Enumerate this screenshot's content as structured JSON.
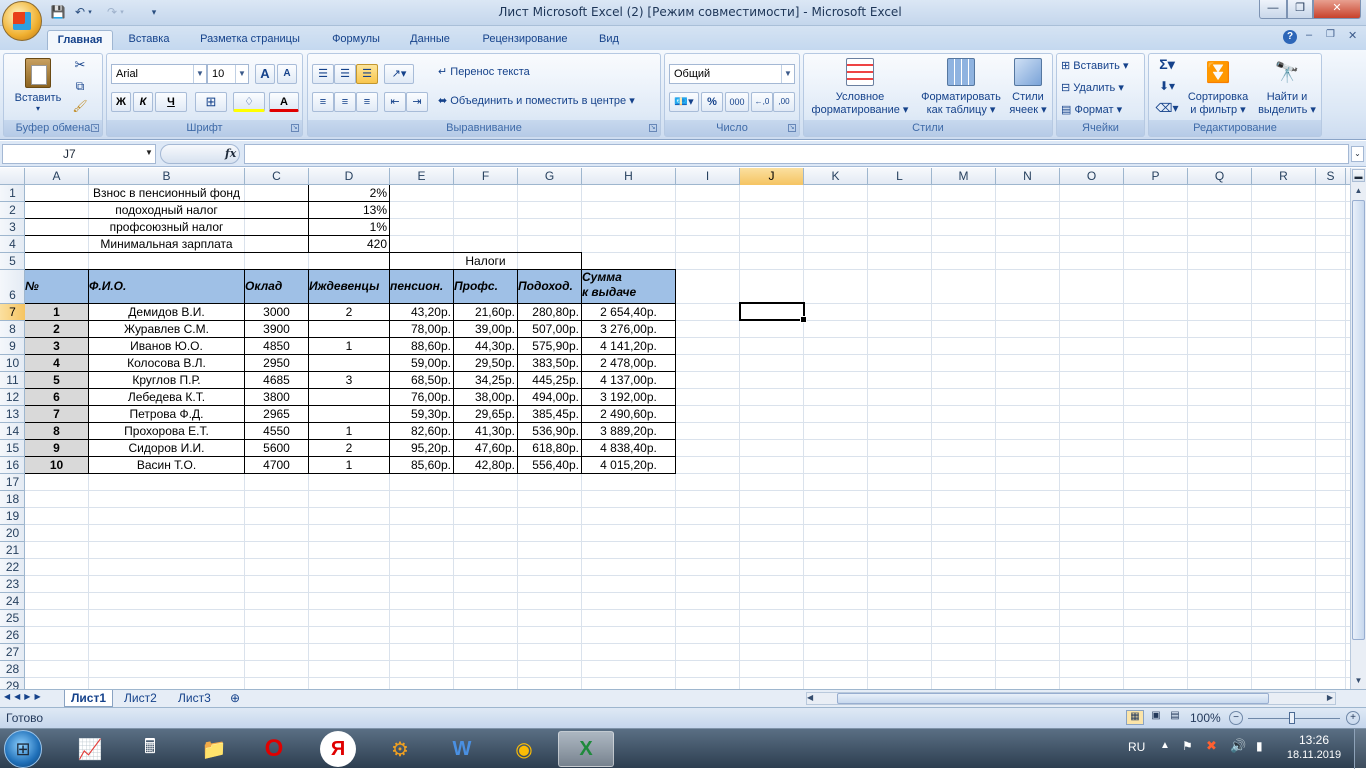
{
  "window": {
    "title": "Лист Microsoft Excel (2)  [Режим совместимости] - Microsoft Excel",
    "min": "—",
    "max": "❐",
    "close": "✕"
  },
  "ribbon_tabs": [
    "Главная",
    "Вставка",
    "Разметка страницы",
    "Формулы",
    "Данные",
    "Рецензирование",
    "Вид"
  ],
  "ribbon": {
    "clipboard": {
      "label": "Буфер обмена",
      "paste": "Вставить"
    },
    "font": {
      "label": "Шрифт",
      "name": "Arial",
      "size": "10",
      "bold": "Ж",
      "italic": "К",
      "underline": "Ч",
      "grow": "A",
      "shrink": "A",
      "color_letter": "A"
    },
    "alignment": {
      "label": "Выравнивание",
      "wrap": "Перенос текста",
      "merge": "Объединить и поместить в центре"
    },
    "number": {
      "label": "Число",
      "format": "Общий",
      "percent": "%",
      "thousands": "000",
      "inc": "←,0",
      "dec": ",00"
    },
    "styles": {
      "label": "Стили",
      "cond1": "Условное",
      "cond2": "форматирование",
      "table1": "Форматировать",
      "table2": "как таблицу",
      "cell1": "Стили",
      "cell2": "ячеек"
    },
    "cells": {
      "label": "Ячейки",
      "insert": "Вставить",
      "delete": "Удалить",
      "format": "Формат"
    },
    "editing": {
      "label": "Редактирование",
      "sort1": "Сортировка",
      "sort2": "и фильтр",
      "find1": "Найти и",
      "find2": "выделить",
      "sigma": "Σ"
    }
  },
  "formula_bar": {
    "name_box": "J7",
    "fx": "fx",
    "value": ""
  },
  "columns": [
    "A",
    "B",
    "C",
    "D",
    "E",
    "F",
    "G",
    "H",
    "I",
    "J",
    "K",
    "L",
    "M",
    "N",
    "O",
    "P",
    "Q",
    "R",
    "S"
  ],
  "rows": [
    "1",
    "2",
    "3",
    "4",
    "5",
    "6",
    "7",
    "8",
    "9",
    "10",
    "11",
    "12",
    "13",
    "14",
    "15",
    "16",
    "17",
    "18",
    "19",
    "20",
    "21",
    "22",
    "23",
    "24",
    "25",
    "26",
    "27",
    "28",
    "29"
  ],
  "selected": {
    "column": "J",
    "row": "7"
  },
  "params": [
    {
      "label": "Взнос в пенсионный фонд",
      "value": "2%"
    },
    {
      "label": "подоходный налог",
      "value": "13%"
    },
    {
      "label": "профсоюзный налог",
      "value": "1%"
    },
    {
      "label": "Минимальная зарплата",
      "value": "420"
    }
  ],
  "taxes_caption": "Налоги",
  "table_headers": [
    "№",
    "Ф.И.О.",
    "Оклад",
    "Иждевенцы",
    "пенсион.",
    "Профс.",
    "Подоход.",
    "Сумма",
    "к выдаче"
  ],
  "table_rows": [
    [
      "1",
      "Демидов В.И.",
      "3000",
      "2",
      "43,20р.",
      "21,60р.",
      "280,80р.",
      "2 654,40р."
    ],
    [
      "2",
      "Журавлев С.М.",
      "3900",
      "",
      "78,00р.",
      "39,00р.",
      "507,00р.",
      "3 276,00р."
    ],
    [
      "3",
      "Иванов Ю.О.",
      "4850",
      "1",
      "88,60р.",
      "44,30р.",
      "575,90р.",
      "4 141,20р."
    ],
    [
      "4",
      "Колосова В.Л.",
      "2950",
      "",
      "59,00р.",
      "29,50р.",
      "383,50р.",
      "2 478,00р."
    ],
    [
      "5",
      "Круглов П.Р.",
      "4685",
      "3",
      "68,50р.",
      "34,25р.",
      "445,25р.",
      "4 137,00р."
    ],
    [
      "6",
      "Лебедева К.Т.",
      "3800",
      "",
      "76,00р.",
      "38,00р.",
      "494,00р.",
      "3 192,00р."
    ],
    [
      "7",
      "Петрова Ф.Д.",
      "2965",
      "",
      "59,30р.",
      "29,65р.",
      "385,45р.",
      "2 490,60р."
    ],
    [
      "8",
      "Прохорова Е.Т.",
      "4550",
      "1",
      "82,60р.",
      "41,30р.",
      "536,90р.",
      "3 889,20р."
    ],
    [
      "9",
      "Сидоров И.И.",
      "5600",
      "2",
      "95,20р.",
      "47,60р.",
      "618,80р.",
      "4 838,40р."
    ],
    [
      "10",
      "Васин Т.О.",
      "4700",
      "1",
      "85,60р.",
      "42,80р.",
      "556,40р.",
      "4 015,20р."
    ]
  ],
  "sheets": [
    "Лист1",
    "Лист2",
    "Лист3"
  ],
  "status": {
    "ready": "Готово",
    "zoom": "100%"
  },
  "taskbar": {
    "lang": "RU",
    "time": "13:26",
    "date": "18.11.2019"
  },
  "colors": {
    "header_fill": "#9fc0e6",
    "selection": "#f5c462",
    "ribbon": "#dbe7f5"
  }
}
